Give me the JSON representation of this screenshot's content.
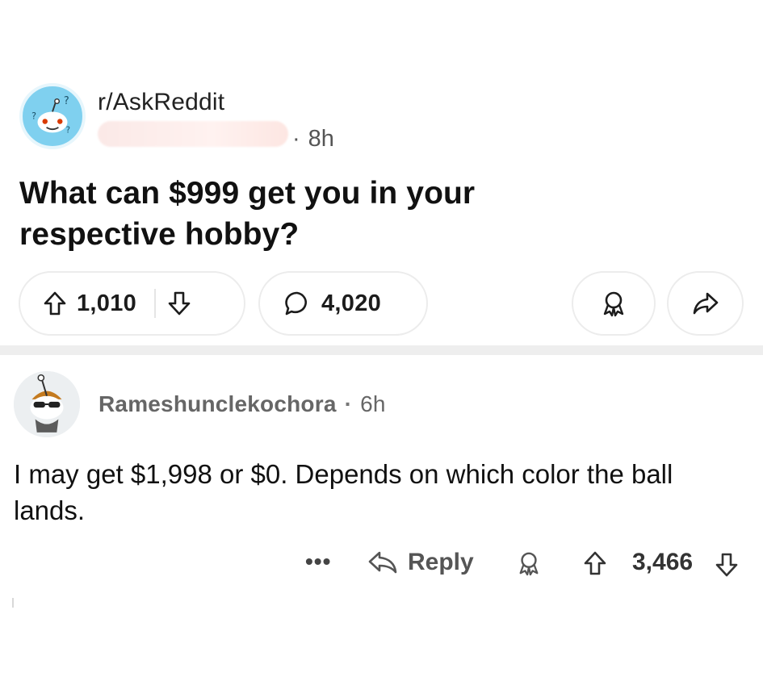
{
  "post": {
    "subreddit": "r/AskReddit",
    "time": "8h",
    "title": "What can $999 get you in your respective hobby?",
    "upvotes": "1,010",
    "comments": "4,020"
  },
  "comment": {
    "username": "Rameshunclekochora",
    "time": "6h",
    "body": "I may get $1,998 or $0. Depends on which color the ball lands.",
    "more_label": "•••",
    "reply_label": "Reply",
    "score": "3,466"
  },
  "icons": {
    "upvote": "arrow-up-icon",
    "downvote": "arrow-down-icon",
    "comment": "speech-bubble-icon",
    "award": "award-icon",
    "share": "share-arrow-icon",
    "reply": "reply-arrow-icon"
  },
  "colors": {
    "subreddit_avatar_bg": "#7fd0ef",
    "pill_border": "#ececec",
    "divider": "#eeeeee",
    "meta_text": "#666666"
  }
}
